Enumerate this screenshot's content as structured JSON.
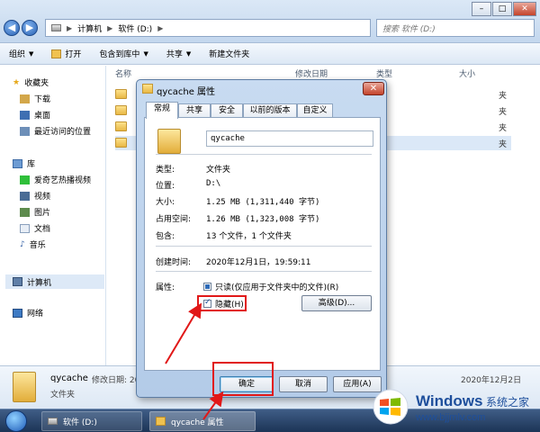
{
  "explorer": {
    "address": [
      "计算机",
      "软件 (D:)"
    ],
    "search_placeholder": "搜索 软件 (D:)",
    "toolbar": [
      "组织",
      "打开",
      "包含到库中",
      "共享",
      "新建文件夹"
    ],
    "columns": [
      "名称",
      "修改日期",
      "类型",
      "大小"
    ],
    "type_values": [
      "夹",
      "夹",
      "夹",
      "夹"
    ]
  },
  "sidebar": {
    "favorites": "收藏夹",
    "favorites_items": [
      "下载",
      "桌面",
      "最近访问的位置"
    ],
    "libraries": "库",
    "library_items": [
      "爱奇艺热播视频",
      "视频",
      "图片",
      "文档",
      "音乐"
    ],
    "computer": "计算机",
    "network": "网络"
  },
  "details": {
    "name": "qycache",
    "modified_label": "修改日期: 20",
    "type": "文件夹",
    "right_fragment": "2020年12月2日"
  },
  "taskbar": {
    "items": [
      "软件 (D:)",
      "qycache 属性"
    ]
  },
  "dialog": {
    "title": "qycache 属性",
    "close_label": "✕",
    "tabs": [
      "常规",
      "共享",
      "安全",
      "以前的版本",
      "自定义"
    ],
    "folder_name": "qycache",
    "rows": [
      {
        "label": "类型:",
        "value": "文件夹"
      },
      {
        "label": "位置:",
        "value": "D:\\"
      },
      {
        "label": "大小:",
        "value": "1.25 MB (1,311,440 字节)"
      },
      {
        "label": "占用空间:",
        "value": "1.26 MB (1,323,008 字节)"
      },
      {
        "label": "包含:",
        "value": "13 个文件，1 个文件夹"
      },
      {
        "label": "创建时间:",
        "value": "2020年12月1日，19:59:11"
      }
    ],
    "attributes_label": "属性:",
    "readonly_label": "只读(仅应用于文件夹中的文件)(R)",
    "hidden_label": "隐藏(H)",
    "advanced_button": "高级(D)...",
    "ok_button": "确定",
    "cancel_button": "取消",
    "apply_button": "应用(A)"
  },
  "watermark": {
    "brand": "Windows",
    "cn": "系统之家",
    "url": "www.bjjmlv.com"
  }
}
